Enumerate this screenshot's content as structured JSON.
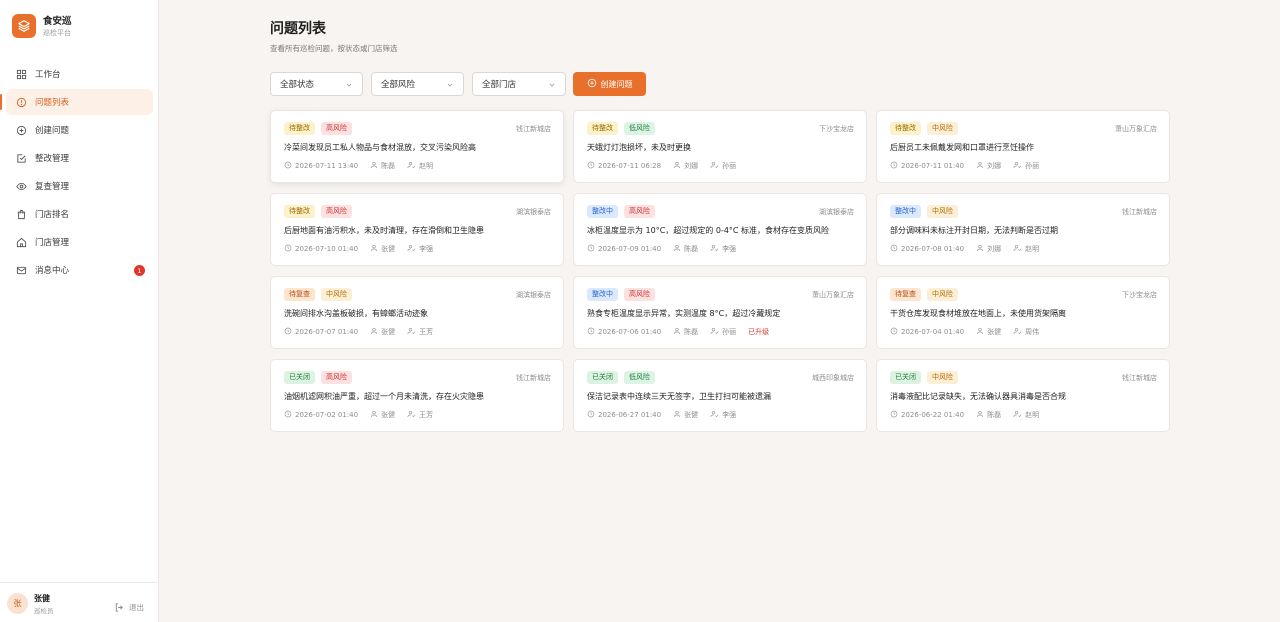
{
  "brand": {
    "name": "食安巡",
    "sub": "巡检平台"
  },
  "nav": [
    {
      "label": "工作台",
      "icon": "dashboard-icon"
    },
    {
      "label": "问题列表",
      "icon": "alert-circle-icon",
      "active": true
    },
    {
      "label": "创建问题",
      "icon": "plus-circle-icon"
    },
    {
      "label": "整改管理",
      "icon": "check-square-icon"
    },
    {
      "label": "复查管理",
      "icon": "eye-icon"
    },
    {
      "label": "门店排名",
      "icon": "shopping-bag-icon"
    },
    {
      "label": "门店管理",
      "icon": "home-icon"
    },
    {
      "label": "消息中心",
      "icon": "mail-icon",
      "badge": "1"
    }
  ],
  "user": {
    "avatar": "张",
    "name": "张健",
    "role": "巡检员",
    "logout": "退出"
  },
  "page": {
    "title": "问题列表",
    "subtitle": "查看所有巡检问题，按状态或门店筛选"
  },
  "filters": {
    "status": "全部状态",
    "risk": "全部风险",
    "store": "全部门店",
    "create": "创建问题"
  },
  "colors": {
    "accent": "#e8702a",
    "danger": "#d93b30"
  },
  "issues": [
    {
      "status": "待整改",
      "risk": "高风险",
      "store": "钱江新城店",
      "desc": "冷菜间发现员工私人物品与食材混放，交叉污染风险高",
      "time": "2026-07-11 13:40",
      "reporter": "陈磊",
      "assignee": "赵明"
    },
    {
      "status": "待整改",
      "risk": "低风险",
      "store": "下沙宝龙店",
      "desc": "天蛾灯灯泡损坏，未及时更换",
      "time": "2026-07-11 06:28",
      "reporter": "刘娜",
      "assignee": "孙丽"
    },
    {
      "status": "待整改",
      "risk": "中风险",
      "store": "萧山万象汇店",
      "desc": "后厨员工未佩戴发网和口罩进行烹饪操作",
      "time": "2026-07-11 01:40",
      "reporter": "刘娜",
      "assignee": "孙丽"
    },
    {
      "status": "待整改",
      "risk": "高风险",
      "store": "湖滨银泰店",
      "desc": "后厨地面有油污积水，未及时清理，存在滑倒和卫生隐患",
      "time": "2026-07-10 01:40",
      "reporter": "张健",
      "assignee": "李强"
    },
    {
      "status": "整改中",
      "risk": "高风险",
      "store": "湖滨银泰店",
      "desc": "冰柜温度显示为 10°C，超过规定的 0-4°C 标准，食材存在变质风险",
      "time": "2026-07-09 01:40",
      "reporter": "陈磊",
      "assignee": "李强"
    },
    {
      "status": "整改中",
      "risk": "中风险",
      "store": "钱江新城店",
      "desc": "部分调味料未标注开封日期，无法判断是否过期",
      "time": "2026-07-08 01:40",
      "reporter": "刘娜",
      "assignee": "赵明"
    },
    {
      "status": "待复查",
      "risk": "中风险",
      "store": "湖滨银泰店",
      "desc": "洗碗间排水沟盖板破损，有蟑螂活动迹象",
      "time": "2026-07-07 01:40",
      "reporter": "张健",
      "assignee": "王芳"
    },
    {
      "status": "整改中",
      "risk": "高风险",
      "store": "萧山万象汇店",
      "desc": "熟食专柜温度显示异常，实测温度 8°C，超过冷藏规定",
      "time": "2026-07-06 01:40",
      "reporter": "陈磊",
      "assignee": "孙丽",
      "escalated": "已升级"
    },
    {
      "status": "待复查",
      "risk": "中风险",
      "store": "下沙宝龙店",
      "desc": "干货仓库发现食材堆放在地面上，未使用货架隔离",
      "time": "2026-07-04 01:40",
      "reporter": "张健",
      "assignee": "周伟"
    },
    {
      "status": "已关闭",
      "risk": "高风险",
      "store": "钱江新城店",
      "desc": "油烟机滤网积油严重，超过一个月未清洗，存在火灾隐患",
      "time": "2026-07-02 01:40",
      "reporter": "张健",
      "assignee": "王芳"
    },
    {
      "status": "已关闭",
      "risk": "低风险",
      "store": "城西印象城店",
      "desc": "保洁记录表中连续三天无签字，卫生打扫可能被遗漏",
      "time": "2026-06-27 01:40",
      "reporter": "张健",
      "assignee": "李强"
    },
    {
      "status": "已关闭",
      "risk": "中风险",
      "store": "钱江新城店",
      "desc": "消毒液配比记录缺失，无法确认器具消毒是否合规",
      "time": "2026-06-22 01:40",
      "reporter": "陈磊",
      "assignee": "赵明"
    }
  ]
}
